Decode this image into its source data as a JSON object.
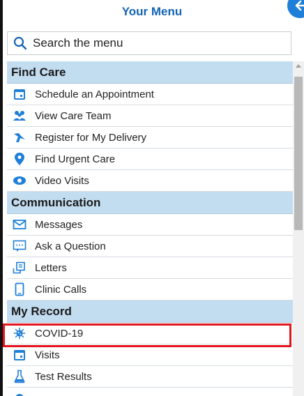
{
  "header": {
    "title": "Your Menu"
  },
  "search": {
    "placeholder": "Search the menu"
  },
  "sections": [
    {
      "label": "Find Care",
      "items": [
        {
          "label": "Schedule an Appointment",
          "icon": "calendar-icon"
        },
        {
          "label": "View Care Team",
          "icon": "care-team-icon"
        },
        {
          "label": "Register for My Delivery",
          "icon": "stork-icon"
        },
        {
          "label": "Find Urgent Care",
          "icon": "location-pin-icon"
        },
        {
          "label": "Video Visits",
          "icon": "video-camera-icon"
        }
      ]
    },
    {
      "label": "Communication",
      "items": [
        {
          "label": "Messages",
          "icon": "envelope-icon"
        },
        {
          "label": "Ask a Question",
          "icon": "chat-bubble-icon"
        },
        {
          "label": "Letters",
          "icon": "letters-icon"
        },
        {
          "label": "Clinic Calls",
          "icon": "phone-icon"
        }
      ]
    },
    {
      "label": "My Record",
      "items": [
        {
          "label": "COVID-19",
          "icon": "virus-icon"
        },
        {
          "label": "Visits",
          "icon": "calendar-icon"
        },
        {
          "label": "Test Results",
          "icon": "flask-icon"
        }
      ]
    }
  ],
  "colors": {
    "accent": "#1463b5",
    "section_bg": "#c2dcf0",
    "highlight": "#e3141b"
  }
}
